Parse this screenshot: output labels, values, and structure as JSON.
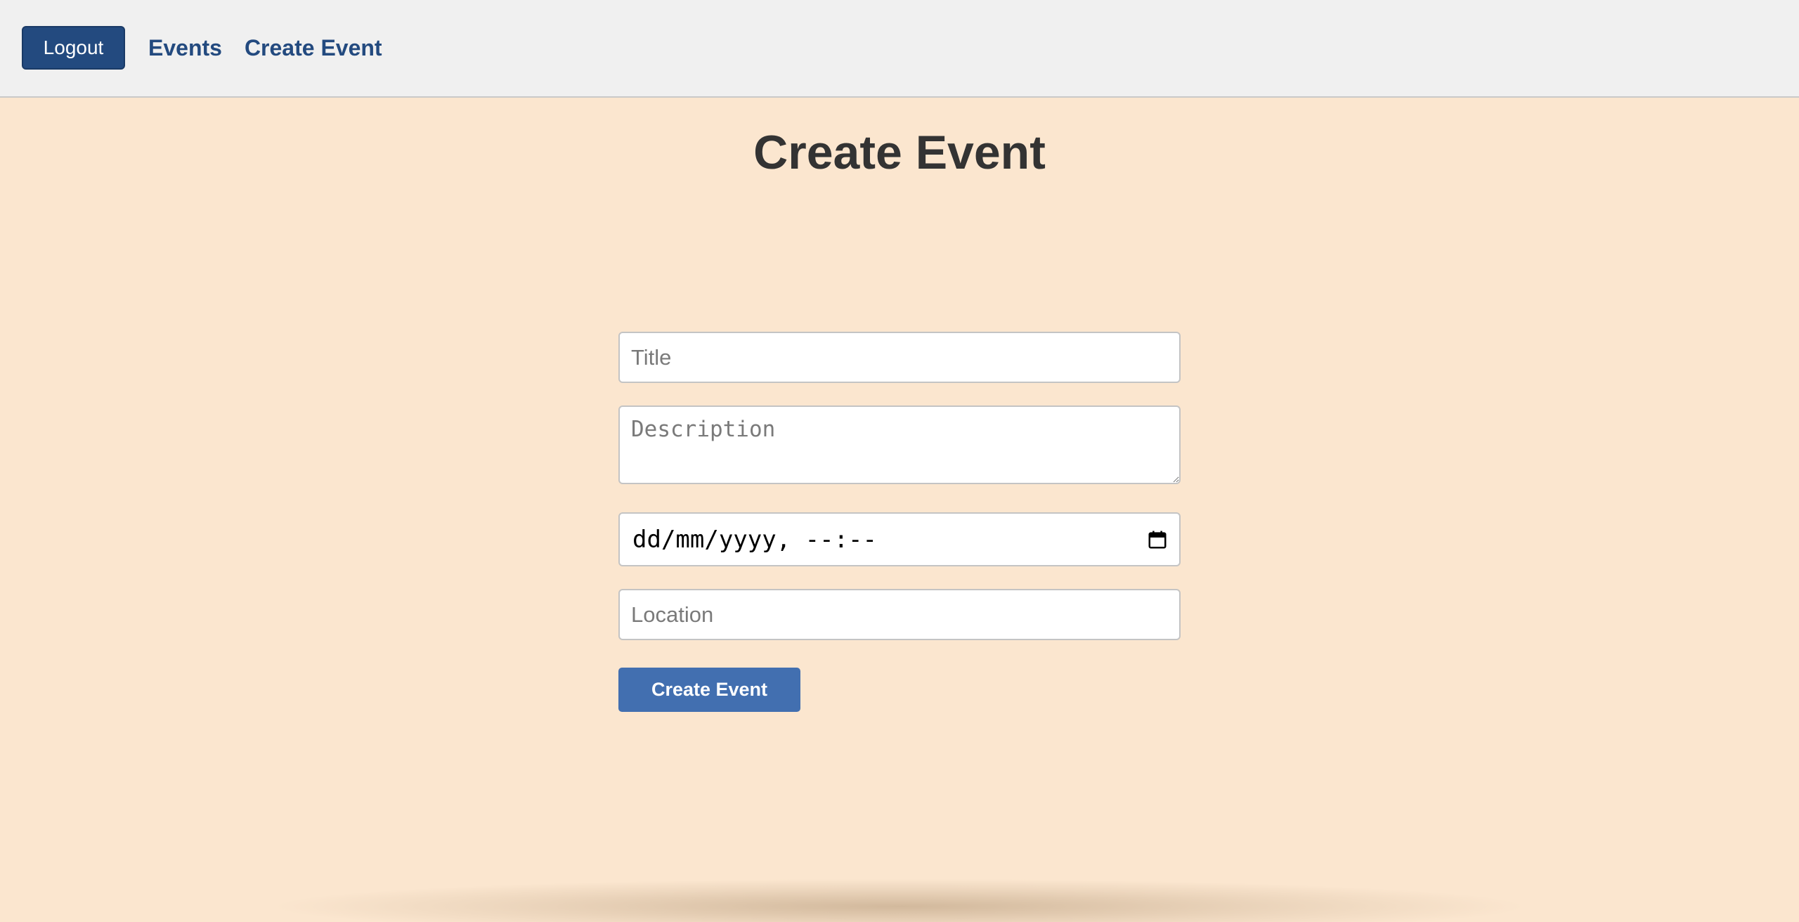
{
  "nav": {
    "logout_label": "Logout",
    "events_label": "Events",
    "create_event_label": "Create Event"
  },
  "page": {
    "title": "Create Event"
  },
  "form": {
    "title_placeholder": "Title",
    "description_placeholder": "Description",
    "datetime_placeholder": "dd/mm/yyyy, --:--",
    "location_placeholder": "Location",
    "submit_label": "Create Event"
  },
  "icons": {
    "datetime_picker": "calendar-icon"
  },
  "colors": {
    "background": "#fbe6cf",
    "navbar": "#f0f0f0",
    "primary_dark": "#234a7f",
    "primary": "#426fb0",
    "heading": "#333333"
  }
}
